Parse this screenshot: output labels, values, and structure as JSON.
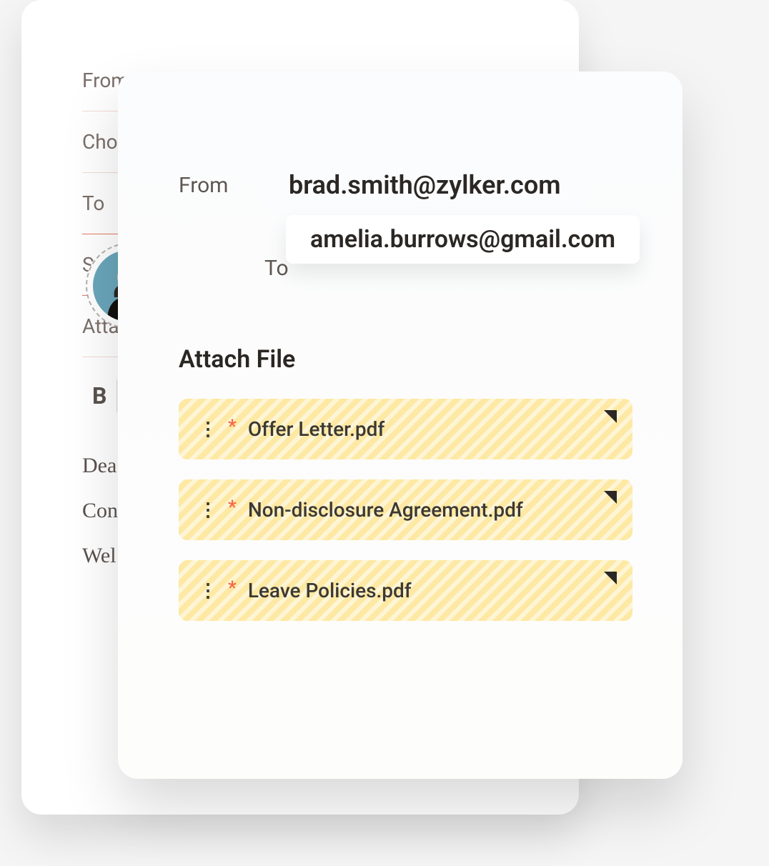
{
  "back": {
    "labels": {
      "from": "From",
      "choose": "Cho",
      "to": "To",
      "subject": "Sub",
      "attach": "Atta"
    },
    "toolbar": {
      "bold": "B"
    },
    "body_lines": [
      "Dea",
      "Con",
      "Wel"
    ]
  },
  "front": {
    "from_label": "From",
    "from_value": "brad.smith@zylker.com",
    "to_label": "To",
    "to_value": "amelia.burrows@gmail.com",
    "attach_title": "Attach File",
    "files": [
      {
        "name": "Offer Letter.pdf"
      },
      {
        "name": "Non-disclosure Agreement.pdf"
      },
      {
        "name": "Leave Policies.pdf"
      }
    ]
  }
}
